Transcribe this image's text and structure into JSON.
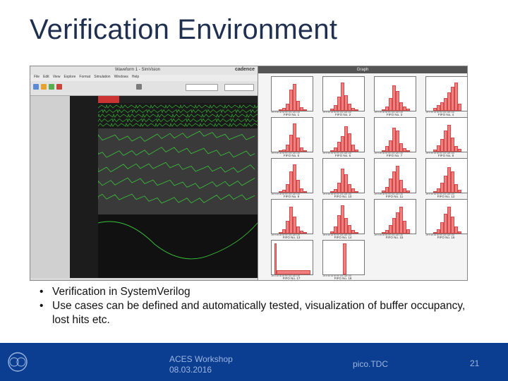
{
  "slide": {
    "title": "Verification Environment",
    "bullets": [
      "Verification in SystemVerilog",
      "Use cases can be defined and automatically tested, visualization of buffer occupancy, lost hits etc."
    ]
  },
  "waveform_window": {
    "title": "Waveform 1 - SimVision",
    "brand": "cadence",
    "menu": [
      "File",
      "Edit",
      "View",
      "Explore",
      "Format",
      "Simulation",
      "Windows",
      "Help"
    ]
  },
  "histogram_window": {
    "title": "Graph",
    "axis_ticks": "-20 0 20 40 60 80 100 120 140",
    "plots": [
      {
        "label": "FIFO No. 1"
      },
      {
        "label": "FIFO No. 2"
      },
      {
        "label": "FIFO No. 3"
      },
      {
        "label": "FIFO No. 4"
      },
      {
        "label": "FIFO No. 5"
      },
      {
        "label": "FIFO No. 6"
      },
      {
        "label": "FIFO No. 7"
      },
      {
        "label": "FIFO No. 8"
      },
      {
        "label": "FIFO No. 9"
      },
      {
        "label": "FIFO No. 10"
      },
      {
        "label": "FIFO No. 11"
      },
      {
        "label": "FIFO No. 12"
      },
      {
        "label": "FIFO No. 13"
      },
      {
        "label": "FIFO No. 14"
      },
      {
        "label": "FIFO No. 15"
      },
      {
        "label": "FIFO No. 16"
      },
      {
        "label": "FIFO No. 17"
      },
      {
        "label": "FIFO No. 18"
      }
    ]
  },
  "footer": {
    "event_line1": "ACES Workshop",
    "event_line2": "08.03.2016",
    "center": "pico.TDC",
    "page": "21"
  },
  "colors": {
    "title": "#1f2f4f",
    "footer_bg": "#0b3d91",
    "footer_text": "#9db6e0",
    "histogram_bar": "#f08080",
    "waveform_bg": "#1a1a1a",
    "waveform_trace": "#39c639"
  }
}
